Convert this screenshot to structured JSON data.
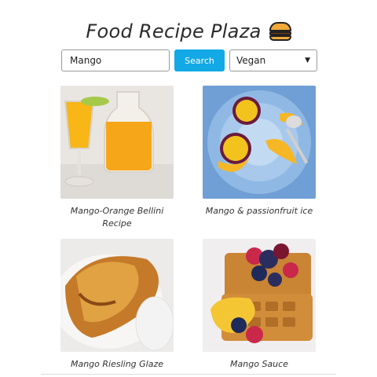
{
  "header": {
    "title": "Food Recipe Plaza"
  },
  "search": {
    "value": "Mango",
    "button_label": "Search"
  },
  "filter": {
    "selected": "Vegan"
  },
  "recipes": [
    {
      "name": "Mango-Orange Bellini Recipe"
    },
    {
      "name": "Mango & passionfruit ice"
    },
    {
      "name": "Mango Riesling Glaze"
    },
    {
      "name": "Mango Sauce"
    }
  ],
  "colors": {
    "accent": "#13a9e6",
    "text": "#222222"
  }
}
